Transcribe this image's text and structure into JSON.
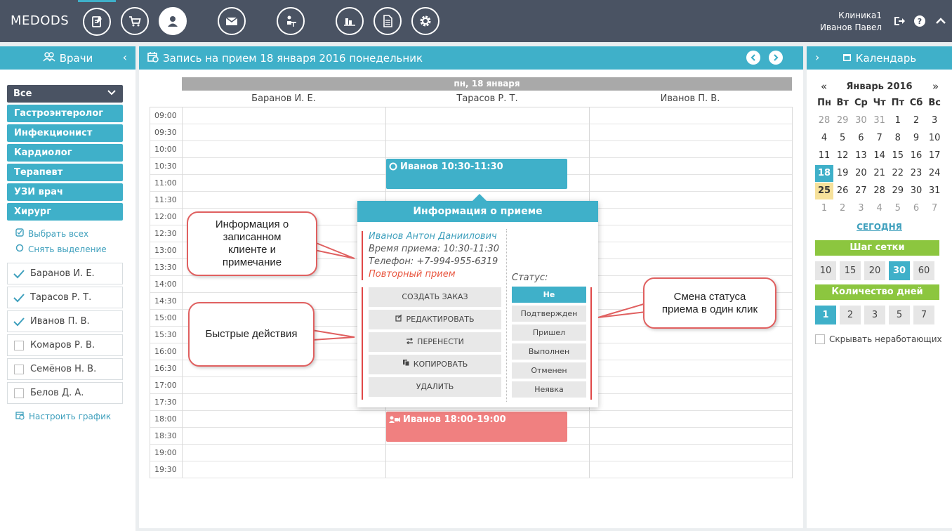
{
  "app": {
    "logo": "MEDODS",
    "clinic": "Клиника1",
    "user": "Иванов Павел"
  },
  "nav_icons": [
    "schedule-icon",
    "cart-icon",
    "patient-icon",
    "mail-icon",
    "reception-icon",
    "reports-icon",
    "documents-icon",
    "settings-icon"
  ],
  "left": {
    "title": "Врачи",
    "all_label": "Все",
    "specialties": [
      "Гастроэнтеролог",
      "Инфекционист",
      "Кардиолог",
      "Терапевт",
      "УЗИ врач",
      "Хирург"
    ],
    "select_all": "Выбрать всех",
    "deselect": "Снять выделение",
    "doctors": [
      {
        "name": "Баранов И. Е.",
        "checked": true
      },
      {
        "name": "Тарасов Р. Т.",
        "checked": true
      },
      {
        "name": "Иванов П. В.",
        "checked": true
      },
      {
        "name": "Комаров Р. В.",
        "checked": false
      },
      {
        "name": "Семёнов Н. В.",
        "checked": false
      },
      {
        "name": "Белов Д. А.",
        "checked": false
      }
    ],
    "schedule_link": "Настроить график"
  },
  "main": {
    "title": "Запись на прием 18 января 2016 понедельник",
    "day_label": "пн, 18 января",
    "columns": [
      "Баранов И. Е.",
      "Тарасов Р. Т.",
      "Иванов П. В."
    ],
    "times": [
      "09:00",
      "09:30",
      "10:00",
      "10:30",
      "11:00",
      "11:30",
      "12:00",
      "12:30",
      "13:00",
      "13:30",
      "14:00",
      "14:30",
      "15:00",
      "15:30",
      "16:00",
      "16:30",
      "17:00",
      "17:30",
      "18:00",
      "18:30",
      "19:00",
      "19:30"
    ],
    "appointments": [
      {
        "label": "Иванов 10:30-11:30",
        "color": "#3fb0c9"
      },
      {
        "label": "Иванов 18:00-19:00",
        "color": "#f08080"
      }
    ]
  },
  "popup": {
    "title": "Информация о приеме",
    "patient": "Иванов Антон Даниилович",
    "time": "Время приема: 10:30-11:30",
    "phone": "Телефон: +7-994-955-6319",
    "note": "Повторный прием",
    "actions": [
      "СОЗДАТЬ ЗАКАЗ",
      "РЕДАКТИРОВАТЬ",
      "ПЕРЕНЕСТИ",
      "КОПИРОВАТЬ",
      "УДАЛИТЬ"
    ],
    "status_label": "Статус:",
    "statuses": [
      "Не подтвержден",
      "Подтвержден",
      "Пришел",
      "Выполнен",
      "Отменен",
      "Неявка"
    ]
  },
  "callouts": {
    "info": "Информация о записанном клиенте и примечание",
    "actions": "Быстрые действия",
    "status": "Смена статуса приема в один клик"
  },
  "calendar": {
    "title": "Календарь",
    "month": "Январь 2016",
    "prev": "«",
    "next": "»",
    "dows": [
      "Пн",
      "Вт",
      "Ср",
      "Чт",
      "Пт",
      "Сб",
      "Вс"
    ],
    "weeks": [
      [
        "28",
        "29",
        "30",
        "31",
        "1",
        "2",
        "3"
      ],
      [
        "4",
        "5",
        "6",
        "7",
        "8",
        "9",
        "10"
      ],
      [
        "11",
        "12",
        "13",
        "14",
        "15",
        "16",
        "17"
      ],
      [
        "18",
        "19",
        "20",
        "21",
        "22",
        "23",
        "24"
      ],
      [
        "25",
        "26",
        "27",
        "28",
        "29",
        "30",
        "31"
      ],
      [
        "1",
        "2",
        "3",
        "4",
        "5",
        "6",
        "7"
      ]
    ],
    "selected": "18",
    "today_day": "25",
    "today_link": "СЕГОДНЯ",
    "grid_step_label": "Шаг сетки",
    "grid_steps": [
      "10",
      "15",
      "20",
      "30",
      "60"
    ],
    "grid_step_active": "30",
    "days_label": "Количество дней",
    "days_options": [
      "1",
      "2",
      "3",
      "5",
      "7"
    ],
    "days_active": "1",
    "hide_label": "Скрывать неработающих"
  }
}
